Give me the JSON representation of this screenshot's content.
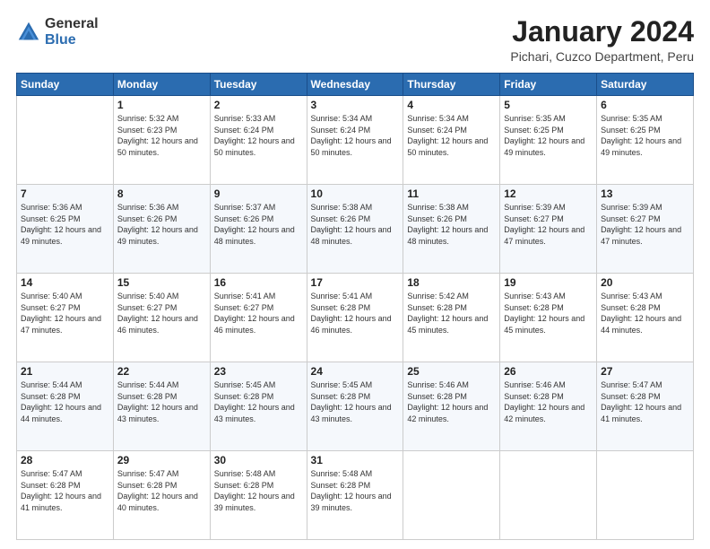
{
  "logo": {
    "general": "General",
    "blue": "Blue"
  },
  "title": "January 2024",
  "subtitle": "Pichari, Cuzco Department, Peru",
  "days_header": [
    "Sunday",
    "Monday",
    "Tuesday",
    "Wednesday",
    "Thursday",
    "Friday",
    "Saturday"
  ],
  "weeks": [
    [
      {
        "day": "",
        "sunrise": "",
        "sunset": "",
        "daylight": ""
      },
      {
        "day": "1",
        "sunrise": "Sunrise: 5:32 AM",
        "sunset": "Sunset: 6:23 PM",
        "daylight": "Daylight: 12 hours and 50 minutes."
      },
      {
        "day": "2",
        "sunrise": "Sunrise: 5:33 AM",
        "sunset": "Sunset: 6:24 PM",
        "daylight": "Daylight: 12 hours and 50 minutes."
      },
      {
        "day": "3",
        "sunrise": "Sunrise: 5:34 AM",
        "sunset": "Sunset: 6:24 PM",
        "daylight": "Daylight: 12 hours and 50 minutes."
      },
      {
        "day": "4",
        "sunrise": "Sunrise: 5:34 AM",
        "sunset": "Sunset: 6:24 PM",
        "daylight": "Daylight: 12 hours and 50 minutes."
      },
      {
        "day": "5",
        "sunrise": "Sunrise: 5:35 AM",
        "sunset": "Sunset: 6:25 PM",
        "daylight": "Daylight: 12 hours and 49 minutes."
      },
      {
        "day": "6",
        "sunrise": "Sunrise: 5:35 AM",
        "sunset": "Sunset: 6:25 PM",
        "daylight": "Daylight: 12 hours and 49 minutes."
      }
    ],
    [
      {
        "day": "7",
        "sunrise": "Sunrise: 5:36 AM",
        "sunset": "Sunset: 6:25 PM",
        "daylight": "Daylight: 12 hours and 49 minutes."
      },
      {
        "day": "8",
        "sunrise": "Sunrise: 5:36 AM",
        "sunset": "Sunset: 6:26 PM",
        "daylight": "Daylight: 12 hours and 49 minutes."
      },
      {
        "day": "9",
        "sunrise": "Sunrise: 5:37 AM",
        "sunset": "Sunset: 6:26 PM",
        "daylight": "Daylight: 12 hours and 48 minutes."
      },
      {
        "day": "10",
        "sunrise": "Sunrise: 5:38 AM",
        "sunset": "Sunset: 6:26 PM",
        "daylight": "Daylight: 12 hours and 48 minutes."
      },
      {
        "day": "11",
        "sunrise": "Sunrise: 5:38 AM",
        "sunset": "Sunset: 6:26 PM",
        "daylight": "Daylight: 12 hours and 48 minutes."
      },
      {
        "day": "12",
        "sunrise": "Sunrise: 5:39 AM",
        "sunset": "Sunset: 6:27 PM",
        "daylight": "Daylight: 12 hours and 47 minutes."
      },
      {
        "day": "13",
        "sunrise": "Sunrise: 5:39 AM",
        "sunset": "Sunset: 6:27 PM",
        "daylight": "Daylight: 12 hours and 47 minutes."
      }
    ],
    [
      {
        "day": "14",
        "sunrise": "Sunrise: 5:40 AM",
        "sunset": "Sunset: 6:27 PM",
        "daylight": "Daylight: 12 hours and 47 minutes."
      },
      {
        "day": "15",
        "sunrise": "Sunrise: 5:40 AM",
        "sunset": "Sunset: 6:27 PM",
        "daylight": "Daylight: 12 hours and 46 minutes."
      },
      {
        "day": "16",
        "sunrise": "Sunrise: 5:41 AM",
        "sunset": "Sunset: 6:27 PM",
        "daylight": "Daylight: 12 hours and 46 minutes."
      },
      {
        "day": "17",
        "sunrise": "Sunrise: 5:41 AM",
        "sunset": "Sunset: 6:28 PM",
        "daylight": "Daylight: 12 hours and 46 minutes."
      },
      {
        "day": "18",
        "sunrise": "Sunrise: 5:42 AM",
        "sunset": "Sunset: 6:28 PM",
        "daylight": "Daylight: 12 hours and 45 minutes."
      },
      {
        "day": "19",
        "sunrise": "Sunrise: 5:43 AM",
        "sunset": "Sunset: 6:28 PM",
        "daylight": "Daylight: 12 hours and 45 minutes."
      },
      {
        "day": "20",
        "sunrise": "Sunrise: 5:43 AM",
        "sunset": "Sunset: 6:28 PM",
        "daylight": "Daylight: 12 hours and 44 minutes."
      }
    ],
    [
      {
        "day": "21",
        "sunrise": "Sunrise: 5:44 AM",
        "sunset": "Sunset: 6:28 PM",
        "daylight": "Daylight: 12 hours and 44 minutes."
      },
      {
        "day": "22",
        "sunrise": "Sunrise: 5:44 AM",
        "sunset": "Sunset: 6:28 PM",
        "daylight": "Daylight: 12 hours and 43 minutes."
      },
      {
        "day": "23",
        "sunrise": "Sunrise: 5:45 AM",
        "sunset": "Sunset: 6:28 PM",
        "daylight": "Daylight: 12 hours and 43 minutes."
      },
      {
        "day": "24",
        "sunrise": "Sunrise: 5:45 AM",
        "sunset": "Sunset: 6:28 PM",
        "daylight": "Daylight: 12 hours and 43 minutes."
      },
      {
        "day": "25",
        "sunrise": "Sunrise: 5:46 AM",
        "sunset": "Sunset: 6:28 PM",
        "daylight": "Daylight: 12 hours and 42 minutes."
      },
      {
        "day": "26",
        "sunrise": "Sunrise: 5:46 AM",
        "sunset": "Sunset: 6:28 PM",
        "daylight": "Daylight: 12 hours and 42 minutes."
      },
      {
        "day": "27",
        "sunrise": "Sunrise: 5:47 AM",
        "sunset": "Sunset: 6:28 PM",
        "daylight": "Daylight: 12 hours and 41 minutes."
      }
    ],
    [
      {
        "day": "28",
        "sunrise": "Sunrise: 5:47 AM",
        "sunset": "Sunset: 6:28 PM",
        "daylight": "Daylight: 12 hours and 41 minutes."
      },
      {
        "day": "29",
        "sunrise": "Sunrise: 5:47 AM",
        "sunset": "Sunset: 6:28 PM",
        "daylight": "Daylight: 12 hours and 40 minutes."
      },
      {
        "day": "30",
        "sunrise": "Sunrise: 5:48 AM",
        "sunset": "Sunset: 6:28 PM",
        "daylight": "Daylight: 12 hours and 39 minutes."
      },
      {
        "day": "31",
        "sunrise": "Sunrise: 5:48 AM",
        "sunset": "Sunset: 6:28 PM",
        "daylight": "Daylight: 12 hours and 39 minutes."
      },
      {
        "day": "",
        "sunrise": "",
        "sunset": "",
        "daylight": ""
      },
      {
        "day": "",
        "sunrise": "",
        "sunset": "",
        "daylight": ""
      },
      {
        "day": "",
        "sunrise": "",
        "sunset": "",
        "daylight": ""
      }
    ]
  ]
}
